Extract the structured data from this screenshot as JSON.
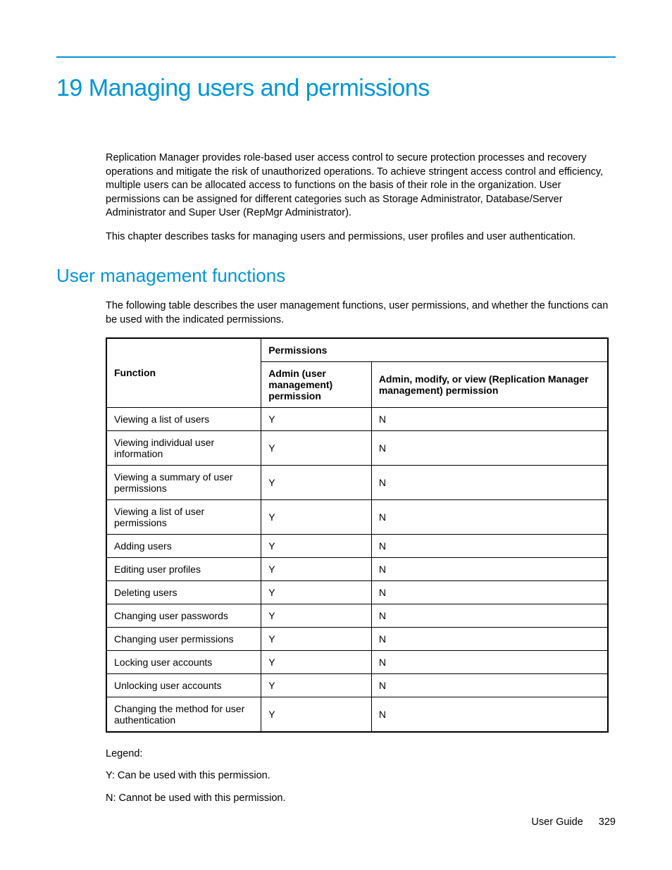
{
  "chapter": {
    "title": "19 Managing users and permissions"
  },
  "intro": {
    "p1": "Replication Manager provides role-based user access control to secure protection processes and recovery operations and mitigate the risk of unauthorized operations. To achieve stringent access control and efficiency, multiple users can be allocated access to functions on the basis of their role in the organization. User permissions can be assigned for different categories such as Storage Administrator, Database/Server Administrator and Super User (RepMgr Administrator).",
    "p2": "This chapter describes tasks for managing users and permissions, user profiles and user authentication."
  },
  "section": {
    "heading": "User management functions",
    "lead": "The following table describes the user management functions, user permissions, and whether the functions can be used with the indicated permissions."
  },
  "table": {
    "headers": {
      "function": "Function",
      "permissions": "Permissions",
      "admin_user": "Admin (user management) permission",
      "admin_rep": "Admin, modify, or view (Replication Manager management) permission"
    },
    "rows": [
      {
        "function": "Viewing a list of users",
        "admin_user": "Y",
        "admin_rep": "N"
      },
      {
        "function": "Viewing individual user information",
        "admin_user": "Y",
        "admin_rep": "N"
      },
      {
        "function": "Viewing a summary of user permissions",
        "admin_user": "Y",
        "admin_rep": "N"
      },
      {
        "function": "Viewing a list of user permissions",
        "admin_user": "Y",
        "admin_rep": "N"
      },
      {
        "function": "Adding users",
        "admin_user": "Y",
        "admin_rep": "N"
      },
      {
        "function": "Editing user profiles",
        "admin_user": "Y",
        "admin_rep": "N"
      },
      {
        "function": "Deleting users",
        "admin_user": "Y",
        "admin_rep": "N"
      },
      {
        "function": "Changing user passwords",
        "admin_user": "Y",
        "admin_rep": "N"
      },
      {
        "function": "Changing user permissions",
        "admin_user": "Y",
        "admin_rep": "N"
      },
      {
        "function": "Locking user accounts",
        "admin_user": "Y",
        "admin_rep": "N"
      },
      {
        "function": "Unlocking user accounts",
        "admin_user": "Y",
        "admin_rep": "N"
      },
      {
        "function": "Changing the method for user authentication",
        "admin_user": "Y",
        "admin_rep": "N"
      }
    ]
  },
  "legend": {
    "label": "Legend:",
    "y": "Y: Can be used with this permission.",
    "n": "N: Cannot be used with this permission."
  },
  "footer": {
    "doc": "User Guide",
    "page": "329"
  }
}
